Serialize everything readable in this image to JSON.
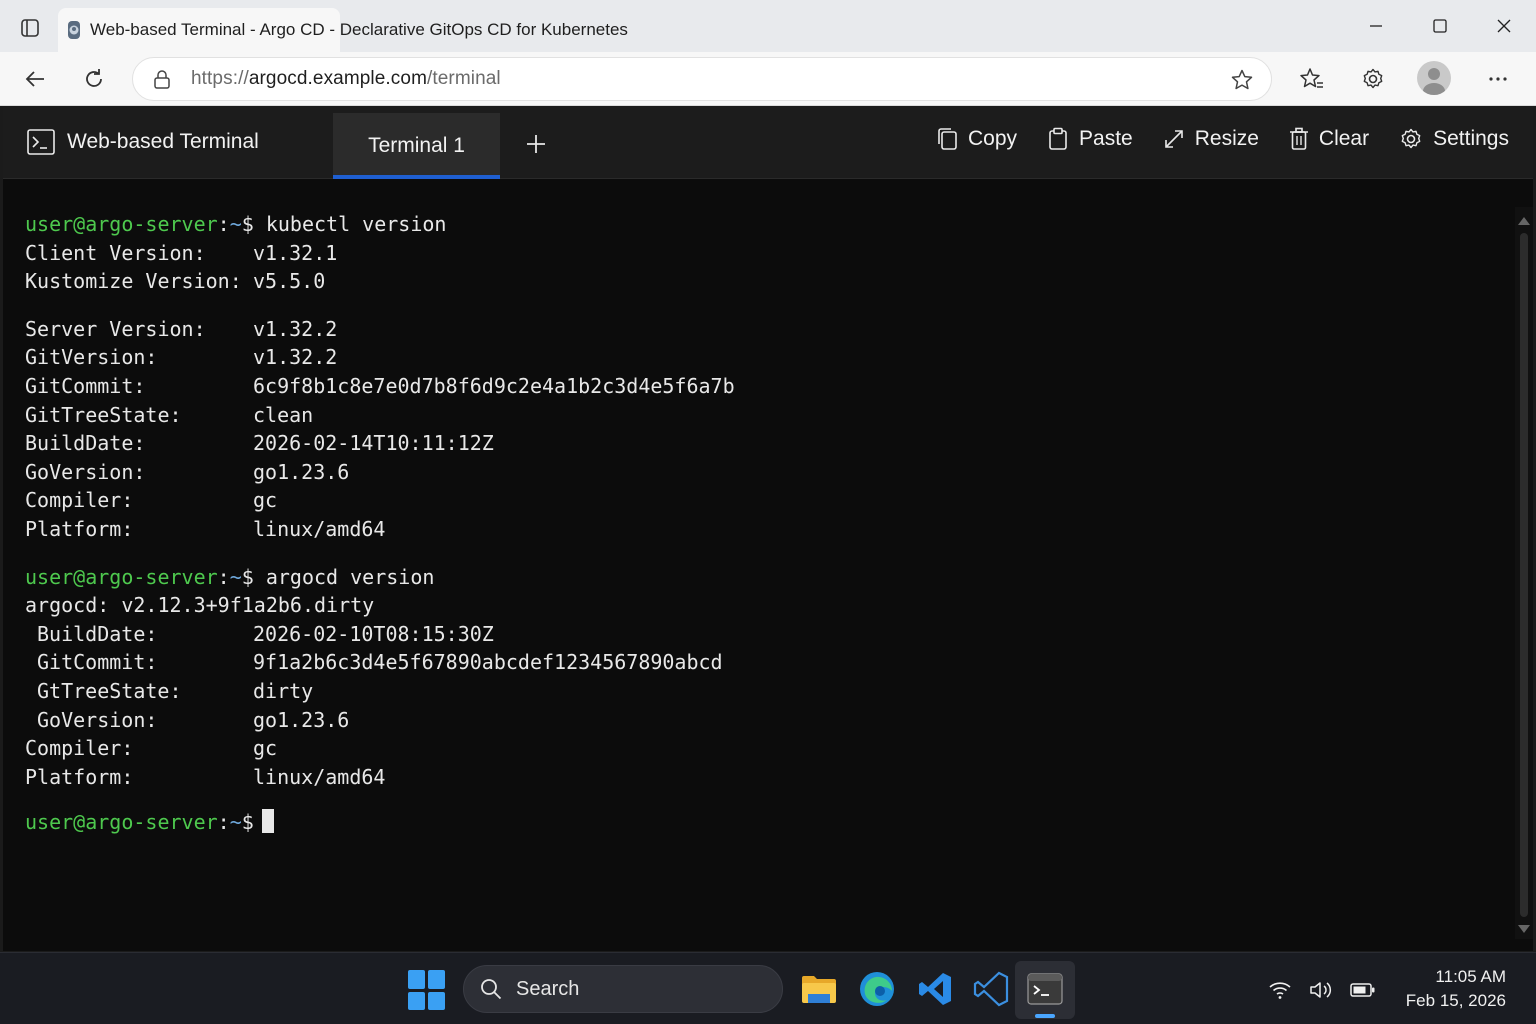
{
  "browser": {
    "tab_title": "Web-based Terminal - Argo CD - Declarative GitOps CD for Kubernetes",
    "url_scheme": "https://",
    "url_host": "argocd.example.com",
    "url_path": "/terminal"
  },
  "app": {
    "brand": "Web-based Terminal",
    "active_tab": "Terminal 1",
    "toolbar": {
      "copy": "Copy",
      "paste": "Paste",
      "resize": "Resize",
      "clear": "Clear",
      "settings": "Settings"
    }
  },
  "terminal": {
    "prompt_user": "user@argo-server",
    "prompt_sep": ":",
    "prompt_path": "~",
    "prompt_symbol": "$",
    "cmd1": " kubectl version",
    "client": [
      {
        "k": "Client Version:",
        "v": "v1.32.1"
      },
      {
        "k": "Kustomize Version:",
        "v": "v5.5.0"
      }
    ],
    "server": [
      {
        "k": "Server Version:",
        "v": "v1.32.2"
      },
      {
        "k": "GitVersion:",
        "v": "v1.32.2"
      },
      {
        "k": "GitCommit:",
        "v": "6c9f8b1c8e7e0d7b8f6d9c2e4a1b2c3d4e5f6a7b"
      },
      {
        "k": "GitTreeState:",
        "v": "clean"
      },
      {
        "k": "BuildDate:",
        "v": "2026-02-14T10:11:12Z"
      },
      {
        "k": "GoVersion:",
        "v": "go1.23.6"
      },
      {
        "k": "Compiler:",
        "v": "gc"
      },
      {
        "k": "Platform:",
        "v": "linux/amd64"
      }
    ],
    "cmd2": " argocd version",
    "argocd_line": "argocd: v2.12.3+9f1a2b6.dirty",
    "argocd": [
      {
        "k": "BuildDate:",
        "v": "2026-02-10T08:15:30Z"
      },
      {
        "k": "GitCommit:",
        "v": "9f1a2b6c3d4e5f67890abcdef1234567890abcd"
      },
      {
        "k": "GtTreeState:",
        "v": "dirty"
      },
      {
        "k": "GoVersion:",
        "v": "go1.23.6"
      }
    ],
    "argocd_tail": [
      {
        "k": "Compiler:",
        "v": "gc"
      },
      {
        "k": "Platform:",
        "v": "linux/amd64"
      }
    ]
  },
  "taskbar": {
    "search_label": "Search",
    "time": "11:05 AM",
    "date": "Feb 15, 2026"
  },
  "colors": {
    "prompt_user": "#4ec94e",
    "prompt_path": "#6fa8dc",
    "tab_accent": "#1f5fd1"
  }
}
